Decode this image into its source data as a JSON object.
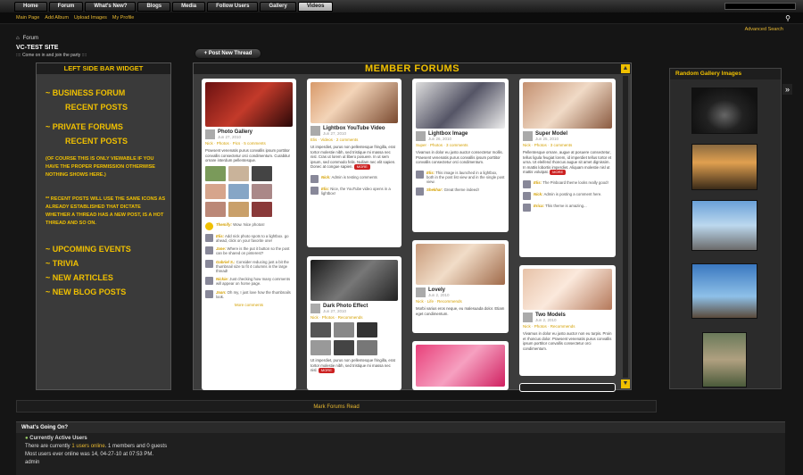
{
  "nav": {
    "tabs": [
      "Home",
      "Forum",
      "What's New?",
      "Blogs",
      "Media",
      "Follow Users",
      "Gallery",
      "Videos"
    ],
    "active_index": 7
  },
  "subnav": {
    "links": [
      "Main Page",
      "Add Album",
      "Upload Images",
      "My Profile"
    ],
    "advanced_search": "Advanced Search"
  },
  "breadcrumb": {
    "label": "Forum"
  },
  "site": {
    "title": "VC-TEST SITE",
    "subtitle": ":::: Come on in and join the party ::::"
  },
  "post_thread_button": "+ Post New Thread",
  "left_sidebar": {
    "heading": "LEFT SIDE BAR WIDGET",
    "business_forum": "~ BUSINESS FORUM",
    "recent_posts_1": "RECENT POSTS",
    "private_forums": "~ PRIVATE FORUMS",
    "recent_posts_2": "RECENT POSTS",
    "note_1": "(OF COURSE THIS IS ONLY VIEWABLE IF YOU HAVE THE PROPER PERMISSION OTHERWISE NOTHING SHOWS HERE.)",
    "note_2": "** RECENT POSTS WILL USE THE SAME ICONS AS ALREADY ESTABLISHED THAT DICTATE WHETHER A THREAD HAS A NEW POST, IS A HOT THREAD AND SO ON.",
    "links": [
      "~ UPCOMING EVENTS",
      "~ TRIVIA",
      "~ NEW ARTICLES",
      "~ NEW BLOG POSTS"
    ]
  },
  "forum": {
    "heading": "MEMBER FORUMS",
    "cards": [
      {
        "title": "Photo Gallery",
        "date": "Jun 27, 2010",
        "tags": "Nick · Photos · Pics · 5 comments",
        "text": "Praesent venenatis purus convallis ipsum porttitor convallis consectetur orci condimentum. Curabitur ornare interdum pellentesque.",
        "comments": [
          {
            "user": "Themify:",
            "text": "Wow. Nice photos!"
          },
          {
            "user": "Elis:",
            "text": "Add nick photo spots to a lightbox. go ahead, click on your favorite one!"
          },
          {
            "user": "Jane:",
            "text": "Where is the put it button so the post can be shared on pinterest?"
          },
          {
            "user": "Gabriel S.:",
            "text": "Consider reducing just a bit the thumbnail size to fit 4 columns in the large thread!"
          },
          {
            "user": "Nickie:",
            "text": "Just checking how many comments will appear on home page."
          },
          {
            "user": "Joan:",
            "text": "Oh my, I just love how the thumbnails look."
          }
        ],
        "more": "More comments"
      },
      {
        "title": "Lightbox YouTube Video",
        "date": "Jun 27, 2010",
        "tags": "Elis · Videos · 2 comments",
        "text": "Ut imperdiet, purus non pellentesque fringilla, erat tortor molestie nibh, sed tristique mi massa nec nisl. Cras ut lorem ut libero posuere. In ut sem ipsum, sed commodo felis. Nullam nec elit sapien. Donec at congue sapien.",
        "more": "MORE",
        "comments": [
          {
            "user": "Nick:",
            "text": "Admin is testing comments"
          },
          {
            "user": "Elis:",
            "text": "Nice, the YouTube video opens in a lightbox!"
          }
        ]
      },
      {
        "title": "Dark Photo Effect",
        "date": "Jun 27, 2010",
        "tags": "Nick · Photos · Recommends",
        "text": "Ut imperdiet, purus non pellentesque fringilla, erat tortor molestie nibh, sed tristique mi massa nec nisl.",
        "more": "MORE"
      },
      {
        "title": "Lightbox Image",
        "date": "Jun 26, 2010",
        "tags": "Super · Photos · 3 comments",
        "text": "Vivamus in dolor eu justo auctor consectetur mollis. Praesent venenatis purus convallis ipsum porttitor convallis consectetur orci condimentum.",
        "comments": [
          {
            "user": "Elis:",
            "text": "This image is launched in a lightbox, both in the post list view and in the single post view."
          },
          {
            "user": "Shekhar:",
            "text": "Great theme indeed!"
          }
        ]
      },
      {
        "title": "Lovely",
        "date": "Jun 2, 2010",
        "tags": "Nick · Life · Recommends",
        "text": "Morbi varius eros neque, eu malesuada dolor. Etiam eget condimentum."
      },
      {
        "title": "Super Model",
        "date": "Jun 25, 2010",
        "tags": "Nick · Photos · 3 comments",
        "text": "Pellentesque ornare, augue at posuere consectetur, tellus ligula feugiat lorem, id imperdiet tellus tortor et urna. Ut eleifend rhoncus augue sit amet dignissim. In mattis lobortis imperdiet. Aliquam molestie nisl ut mattis volutpat.",
        "more": "MORE",
        "comments": [
          {
            "user": "Elis:",
            "text": "The Pinboard theme looks really good!"
          },
          {
            "user": "Nick:",
            "text": "Admin is posting a comment here."
          },
          {
            "user": "Erica:",
            "text": "This theme is amazing..."
          }
        ]
      },
      {
        "title": "Two Models",
        "date": "Jun 2, 2010",
        "tags": "Nick · Photos · Recommends",
        "text": "Vivamus in dolor eu justo auctor non eu turpis. Proin et rhoncus dolor. Praesent venenatis purus convallis ipsum porttitor convallis consectetur orci condimentum."
      }
    ]
  },
  "right_sidebar": {
    "heading": "Random Gallery Images"
  },
  "mark_read": "Mark Forums Read",
  "whats_on": {
    "heading": "What's Going On?",
    "active_users": "Currently Active Users",
    "online_pre": "There are currently ",
    "online_link": "1 users online",
    "online_post": ". 1 members and 0 guests",
    "most_users": "Most users ever online was 14, 04-27-10 at 07:53 PM.",
    "user": "admin"
  },
  "colors": {
    "accent": "#f0c000",
    "link": "#e8b830",
    "panel": "#3a3a3a"
  }
}
